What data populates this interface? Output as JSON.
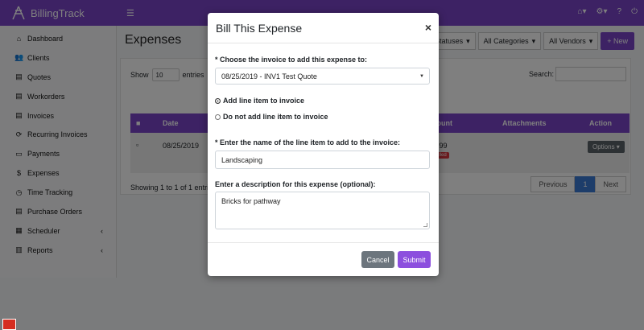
{
  "app": {
    "brand": "BillingTrack"
  },
  "sidebar": {
    "items": [
      {
        "label": "Dashboard",
        "icon": "dashboard-icon",
        "glyph": "⌂"
      },
      {
        "label": "Clients",
        "icon": "users-icon",
        "glyph": "👥"
      },
      {
        "label": "Quotes",
        "icon": "document-icon",
        "glyph": "▤"
      },
      {
        "label": "Workorders",
        "icon": "document-icon",
        "glyph": "▤"
      },
      {
        "label": "Invoices",
        "icon": "document-icon",
        "glyph": "▤"
      },
      {
        "label": "Recurring Invoices",
        "icon": "sync-icon",
        "glyph": "⟳"
      },
      {
        "label": "Payments",
        "icon": "credit-card-icon",
        "glyph": "▭"
      },
      {
        "label": "Expenses",
        "icon": "dollar-icon",
        "glyph": "$"
      },
      {
        "label": "Time Tracking",
        "icon": "clock-icon",
        "glyph": "◷"
      },
      {
        "label": "Purchase Orders",
        "icon": "document-icon",
        "glyph": "▤"
      },
      {
        "label": "Scheduler",
        "icon": "calendar-icon",
        "glyph": "▦",
        "chevron": "‹"
      },
      {
        "label": "Reports",
        "icon": "chart-icon",
        "glyph": "▥",
        "chevron": "‹"
      }
    ]
  },
  "page": {
    "title": "Expenses",
    "filters": {
      "status": "All Statuses",
      "category": "All Categories",
      "vendor": "All Vendors"
    },
    "new_button": "+ New",
    "show_label": "Show",
    "show_value": "10",
    "entries_label": "entries",
    "search_label": "Search:",
    "table": {
      "headers": {
        "date": "Date",
        "amount": "Amount",
        "attachments": "Attachments",
        "action": "Action"
      },
      "row": {
        "date": "08/25/2019",
        "amount": "$12.99",
        "badge": "Billed",
        "options": "Options ▾"
      }
    },
    "showing_text": "Showing 1 to 1 of 1 entries",
    "pager": {
      "previous": "Previous",
      "current": "1",
      "next": "Next"
    }
  },
  "modal": {
    "title": "Bill This Expense",
    "close": "×",
    "invoice_label": "* Choose the invoice to add this expense to:",
    "invoice_value": "08/25/2019 - INV1 Test Quote",
    "radio_add": "Add line item to invoice",
    "radio_no_add": "Do not add line item to invoice",
    "item_name_label": "* Enter the name of the line item to add to the invoice:",
    "item_name_value": "Landscaping",
    "description_label": "Enter a description for this expense (optional):",
    "description_value": "Bricks for pathway",
    "cancel": "Cancel",
    "submit": "Submit"
  },
  "colors": {
    "primary": "#7a45c9",
    "submit": "#8c4fde",
    "cancel": "#6c757d",
    "danger": "#d9363e"
  }
}
